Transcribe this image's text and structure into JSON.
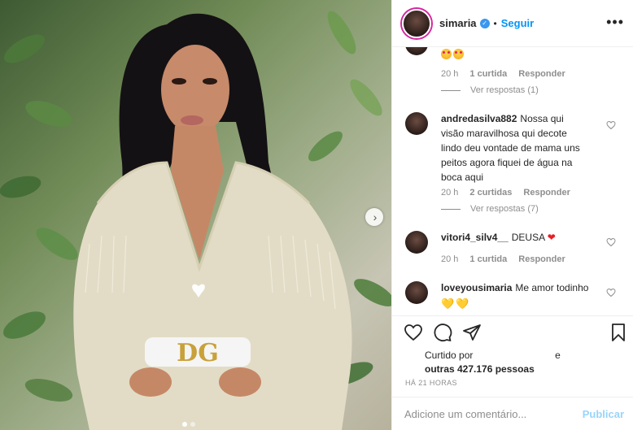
{
  "post": {
    "username": "simaria",
    "follow_label": "Seguir",
    "separator": "•",
    "more_icon": "more-options-icon"
  },
  "comments": [
    {
      "username": "",
      "text": "",
      "emoji": [
        "heart-eyes-emoji",
        "heart-eyes-emoji"
      ],
      "time": "20 h",
      "likes": "1 curtida",
      "reply_label": "Responder",
      "view_replies": "Ver respostas (1)"
    },
    {
      "username": "andredasilva882",
      "text": "Nossa qui visão maravilhosa qui decote lindo deu vontade de mama uns peitos agora fiquei de água na boca aqui",
      "time": "20 h",
      "likes": "2 curtidas",
      "reply_label": "Responder",
      "view_replies": "Ver respostas (7)"
    },
    {
      "username": "vitori4_silv4__",
      "text": "DEUSA",
      "emoji": [
        "red-heart-emoji"
      ],
      "time": "20 h",
      "likes": "1 curtida",
      "reply_label": "Responder"
    },
    {
      "username": "loveyousimaria",
      "text": "Me amor todinho",
      "emoji": [
        "yellow-heart-emoji",
        "yellow-heart-emoji"
      ]
    }
  ],
  "likes": {
    "prefix": "Curtido por",
    "connector": "e",
    "others": "outras 427.176 pessoas"
  },
  "timestamp": "HÁ 21 HORAS",
  "add_comment": {
    "placeholder": "Adicione um comentário...",
    "publish_label": "Publicar"
  },
  "colors": {
    "accent": "#0095f6",
    "verified": "#3897f0",
    "muted": "#8e8e8e",
    "text": "#262626"
  },
  "carousel": {
    "current": 1,
    "total": 2
  }
}
